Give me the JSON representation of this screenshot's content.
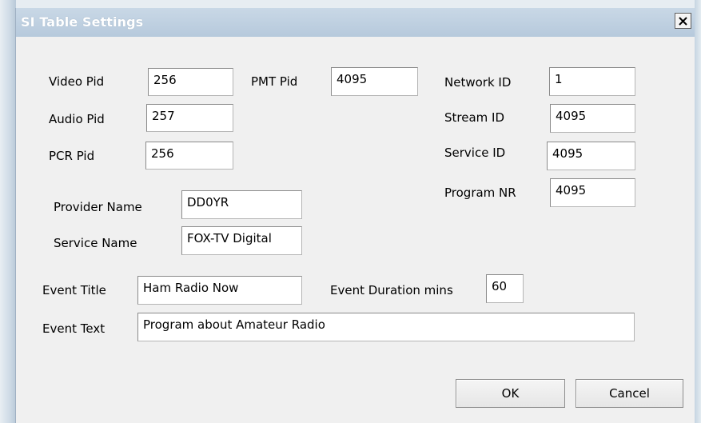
{
  "dialog": {
    "title": "SI Table Settings",
    "close_icon": "close-icon"
  },
  "pids": {
    "video_label": "Video Pid",
    "video_value": "256",
    "audio_label": "Audio Pid",
    "audio_value": "257",
    "pcr_label": "PCR Pid",
    "pcr_value": "256",
    "pmt_label": "PMT Pid",
    "pmt_value": "4095"
  },
  "ids": {
    "network_label": "Network ID",
    "network_value": "1",
    "stream_label": "Stream ID",
    "stream_value": "4095",
    "service_label": "Service ID",
    "service_value": "4095",
    "program_label": "Program NR",
    "program_value": "4095"
  },
  "names": {
    "provider_label": "Provider Name",
    "provider_value": "DD0YR",
    "service_label": "Service Name",
    "service_value": "FOX-TV Digital"
  },
  "event": {
    "title_label": "Event Title",
    "title_value": "Ham Radio Now",
    "duration_label": "Event Duration mins",
    "duration_value": "60",
    "text_label": "Event Text",
    "text_value": "Program about Amateur Radio"
  },
  "buttons": {
    "ok": "OK",
    "cancel": "Cancel"
  }
}
